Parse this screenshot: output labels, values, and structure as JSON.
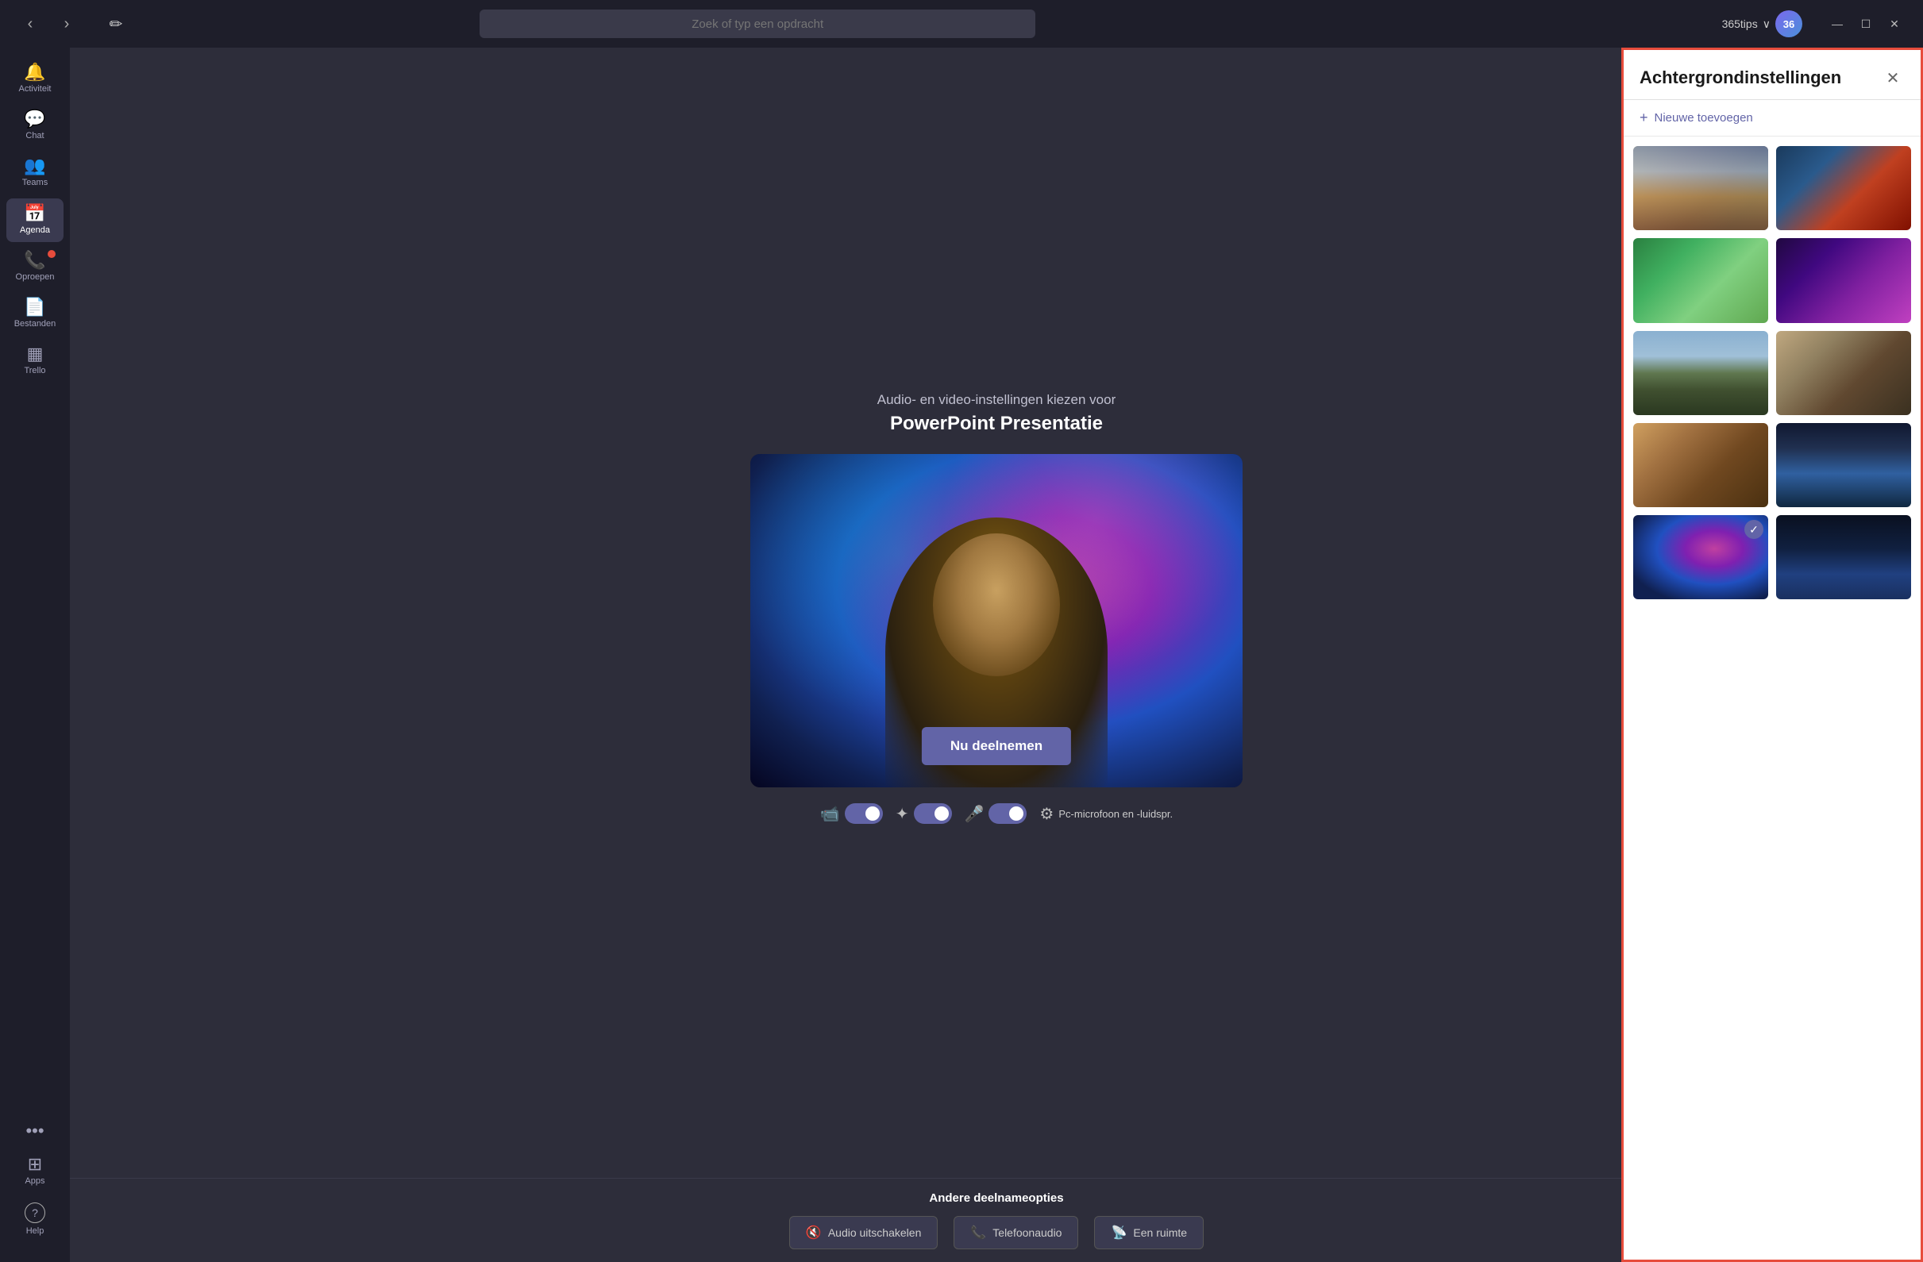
{
  "titleBar": {
    "searchPlaceholder": "Zoek of typ een opdracht",
    "userName": "365tips",
    "windowControls": {
      "minimize": "—",
      "maximize": "☐",
      "close": "✕"
    }
  },
  "sidebar": {
    "items": [
      {
        "id": "activiteit",
        "label": "Activiteit",
        "icon": "🔔",
        "active": false,
        "hasBadge": false
      },
      {
        "id": "chat",
        "label": "Chat",
        "icon": "💬",
        "active": false,
        "hasBadge": false
      },
      {
        "id": "teams",
        "label": "Teams",
        "icon": "👥",
        "active": false,
        "hasBadge": false
      },
      {
        "id": "agenda",
        "label": "Agenda",
        "icon": "📅",
        "active": true,
        "hasBadge": false
      },
      {
        "id": "oproepen",
        "label": "Oproepen",
        "icon": "📞",
        "active": false,
        "hasBadge": true
      },
      {
        "id": "bestanden",
        "label": "Bestanden",
        "icon": "📄",
        "active": false,
        "hasBadge": false
      },
      {
        "id": "trello",
        "label": "Trello",
        "icon": "▦",
        "active": false,
        "hasBadge": false
      }
    ],
    "bottomItems": [
      {
        "id": "more",
        "label": "···",
        "icon": "···",
        "active": false
      },
      {
        "id": "apps",
        "label": "Apps",
        "icon": "⊞",
        "active": false
      },
      {
        "id": "help",
        "label": "Help",
        "icon": "?",
        "active": false
      }
    ]
  },
  "meetingArea": {
    "subtitle": "Audio- en video-instellingen kiezen voor",
    "title": "PowerPoint Presentatie",
    "joinButton": "Nu deelnemen",
    "otherOptionsTitle": "Andere deelnameopties",
    "options": [
      {
        "id": "audio-off",
        "label": "Audio uitschakelen",
        "icon": "🔇"
      },
      {
        "id": "phone",
        "label": "Telefoonaudio",
        "icon": "📞"
      },
      {
        "id": "room",
        "label": "Een ruimte",
        "icon": "📡"
      }
    ],
    "controls": {
      "cameraIcon": "📷",
      "blurIcon": "✦",
      "micIcon": "🎤",
      "settingsIcon": "⚙",
      "settingsLabel": "Pc-microfoon en -luidspr."
    }
  },
  "bgPanel": {
    "title": "Achtergrondinstellingen",
    "addLabel": "Nieuwe toevoegen",
    "closeBtn": "✕",
    "backgrounds": [
      {
        "id": "classroom",
        "class": "bg-classroom",
        "selected": false
      },
      {
        "id": "robot",
        "class": "bg-robot",
        "selected": false
      },
      {
        "id": "minecraft-green",
        "class": "bg-minecraft-green",
        "selected": false
      },
      {
        "id": "minecraft-purple",
        "class": "bg-minecraft-purple",
        "selected": false
      },
      {
        "id": "mountains",
        "class": "bg-mountains",
        "selected": false
      },
      {
        "id": "arch",
        "class": "bg-arch",
        "selected": false
      },
      {
        "id": "door",
        "class": "bg-door",
        "selected": false
      },
      {
        "id": "scifi",
        "class": "bg-scifi",
        "selected": false
      },
      {
        "id": "galaxy",
        "class": "bg-galaxy",
        "selected": true
      },
      {
        "id": "space-person",
        "class": "bg-space-person",
        "selected": false
      }
    ]
  }
}
